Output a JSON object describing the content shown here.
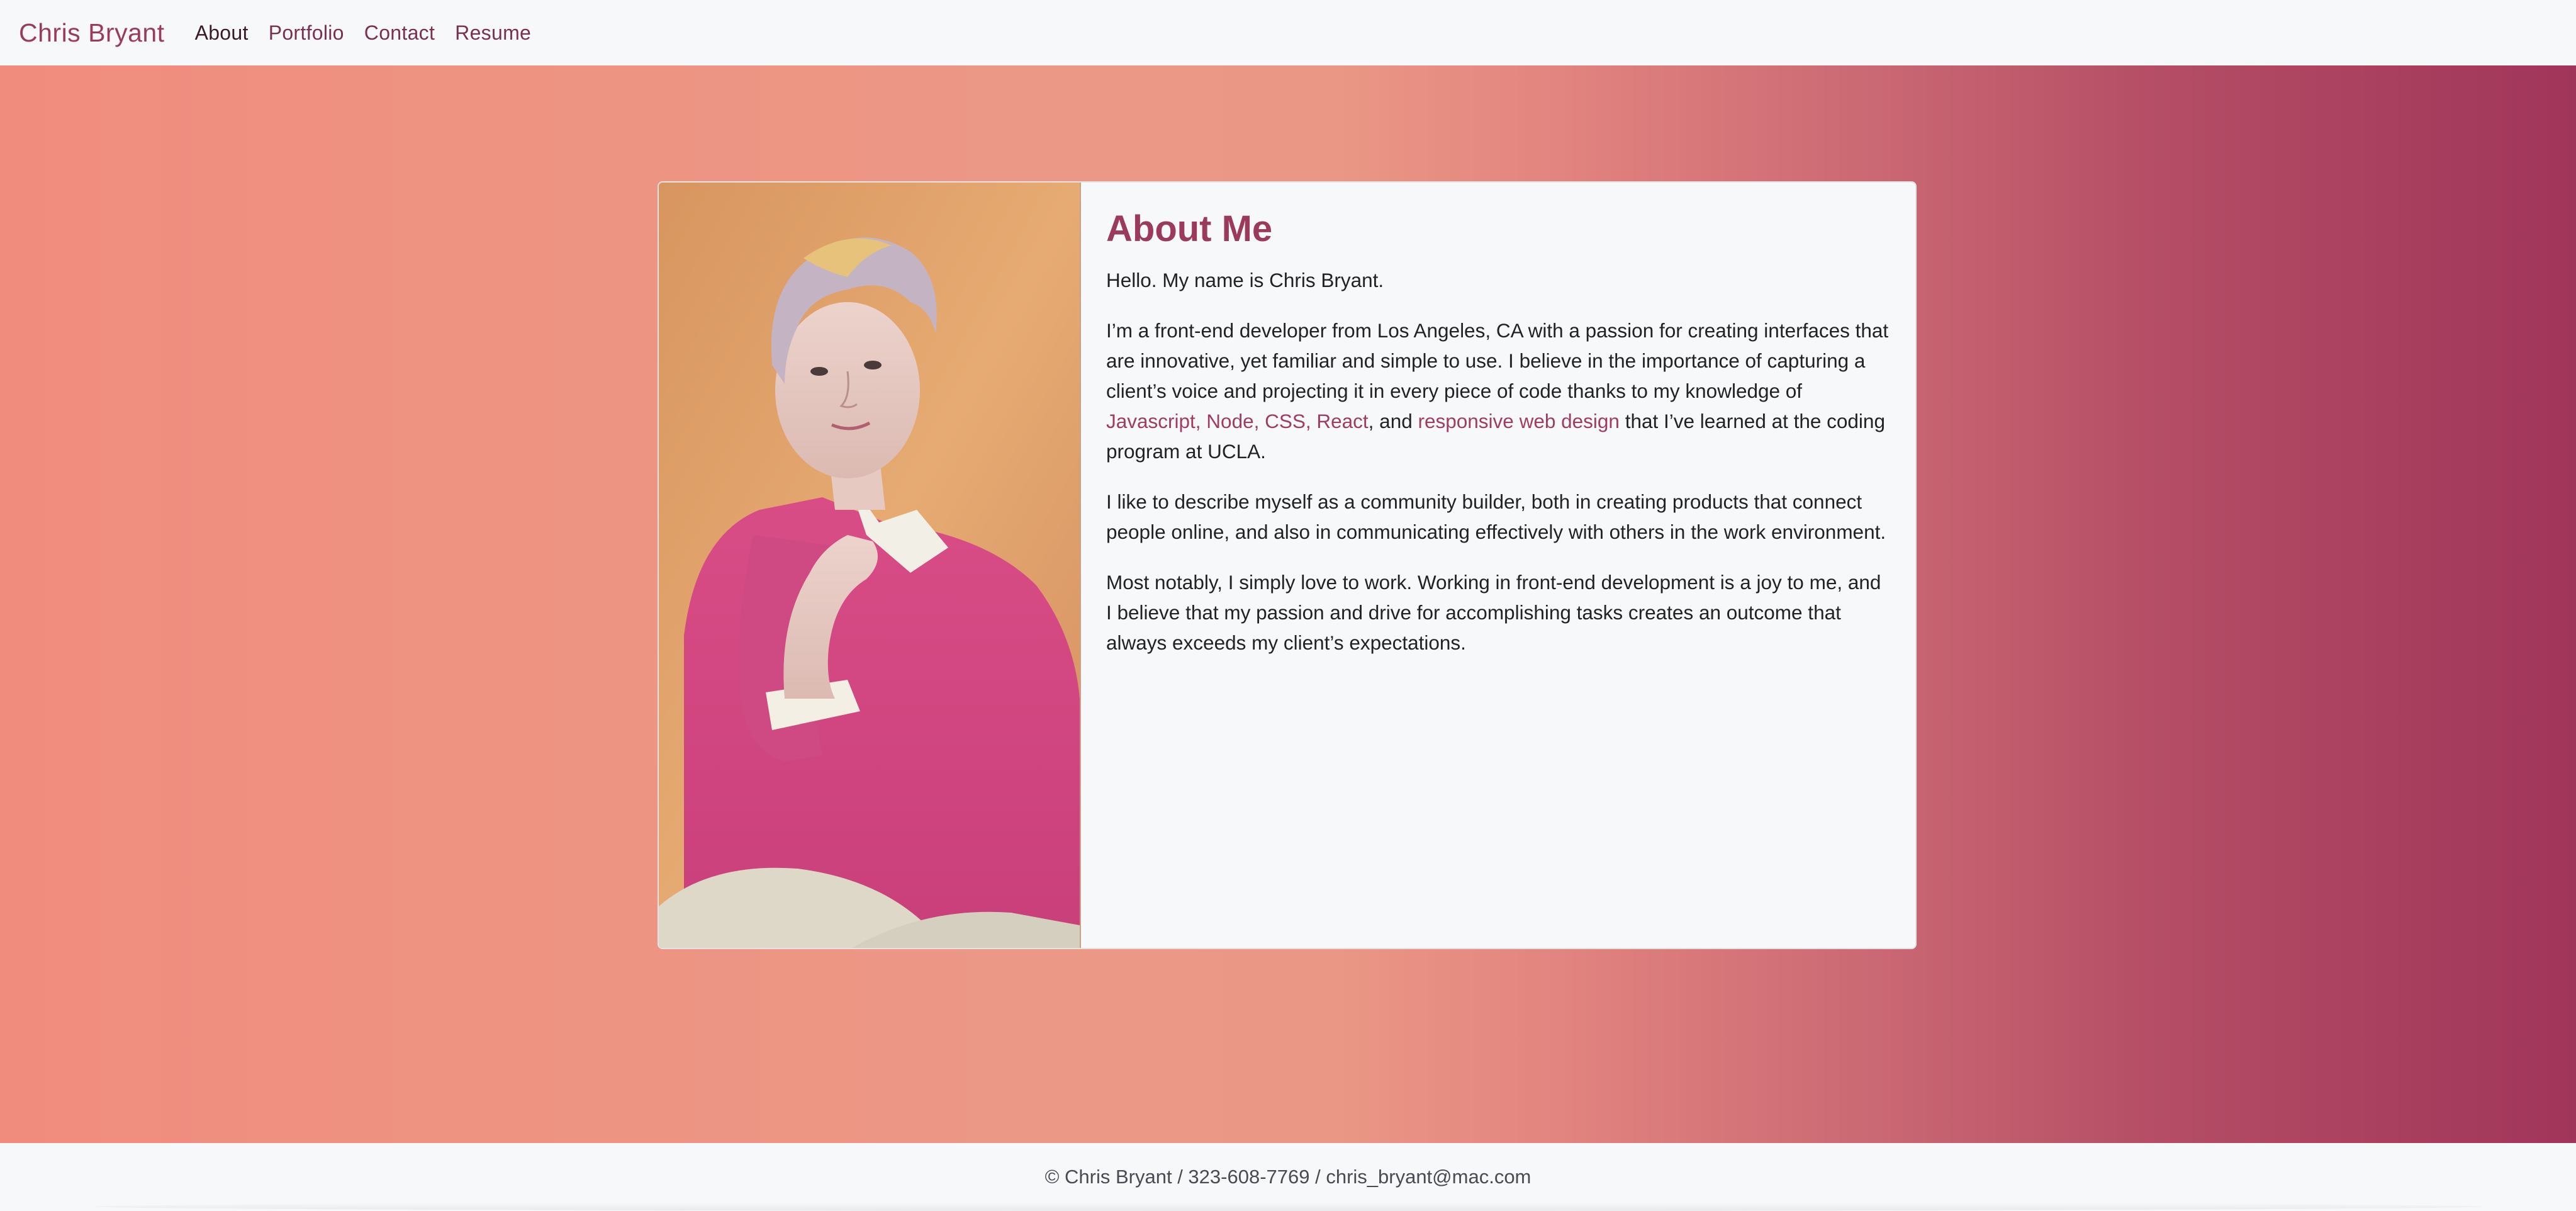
{
  "nav": {
    "brand": "Chris Bryant",
    "links": [
      "About",
      "Portfolio",
      "Contact",
      "Resume"
    ],
    "active": "About"
  },
  "about": {
    "title": "About Me",
    "intro": "Hello. My name is Chris Bryant.",
    "p2_before": "I’m a front-end developer from Los Angeles, CA with a passion for creating interfaces that are innovative, yet familiar and simple to use. I believe in the importance of capturing a client’s voice and projecting it in every piece of code thanks to my knowledge of ",
    "p2_link1": "Javascript, Node, CSS, React",
    "p2_middle": ", and ",
    "p2_link2": "responsive web design",
    "p2_after": " that I’ve learned at the coding program at UCLA.",
    "p3": "I like to describe myself as a community builder, both in creating products that connect people online, and also in communicating effectively with others in the work environment.",
    "p4": "Most notably, I simply love to work. Working in front-end development is a joy to me, and I believe that my passion and drive for accomplishing tasks creates an outcome that always exceeds my client’s expectations."
  },
  "footer": {
    "text": "© Chris Bryant / 323-608-7769 / chris_bryant@mac.com"
  },
  "colors": {
    "accent": "#9c3a5c",
    "gradient_start": "#f08c7e",
    "gradient_end": "#a0355a"
  }
}
